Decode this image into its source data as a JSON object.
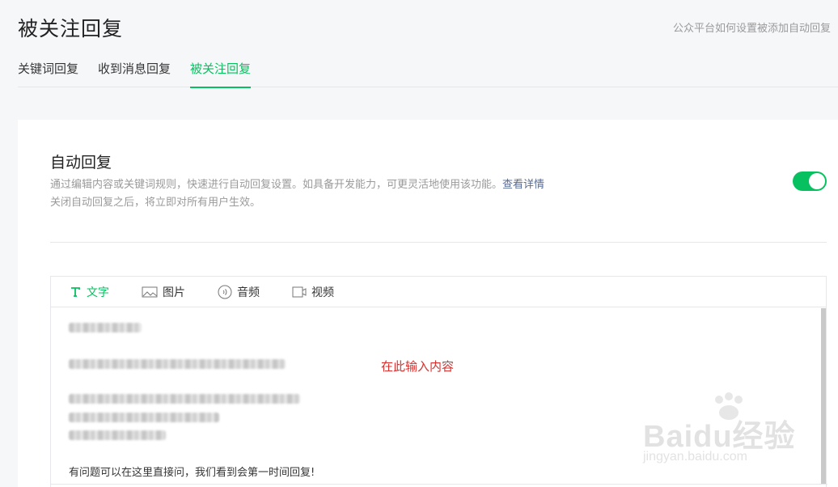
{
  "page": {
    "title": "被关注回复",
    "help_link": "公众平台如何设置被添加自动回复"
  },
  "tabs": [
    {
      "label": "关键词回复",
      "active": false
    },
    {
      "label": "收到消息回复",
      "active": false
    },
    {
      "label": "被关注回复",
      "active": true
    }
  ],
  "auto_reply": {
    "title": "自动回复",
    "desc_line1": "通过编辑内容或关键词规则，快速进行自动回复设置。如具备开发能力，可更灵活地使用该功能。",
    "desc_link": "查看详情",
    "desc_line2": "关闭自动回复之后，将立即对所有用户生效。",
    "enabled": true
  },
  "editor": {
    "tabs": [
      {
        "label": "文字",
        "icon": "text-icon",
        "active": true
      },
      {
        "label": "图片",
        "icon": "image-icon",
        "active": false
      },
      {
        "label": "音频",
        "icon": "audio-icon",
        "active": false
      },
      {
        "label": "视频",
        "icon": "video-icon",
        "active": false
      }
    ],
    "annotation": "在此输入内容",
    "footer_text": "有问题可以在这里直接问，我们看到会第一时间回复!"
  },
  "watermark": {
    "main": "Baidu经验",
    "sub": "jingyan.baidu.com"
  },
  "colors": {
    "accent": "#07c160",
    "annotation": "#d9302d",
    "link": "#576b95"
  }
}
